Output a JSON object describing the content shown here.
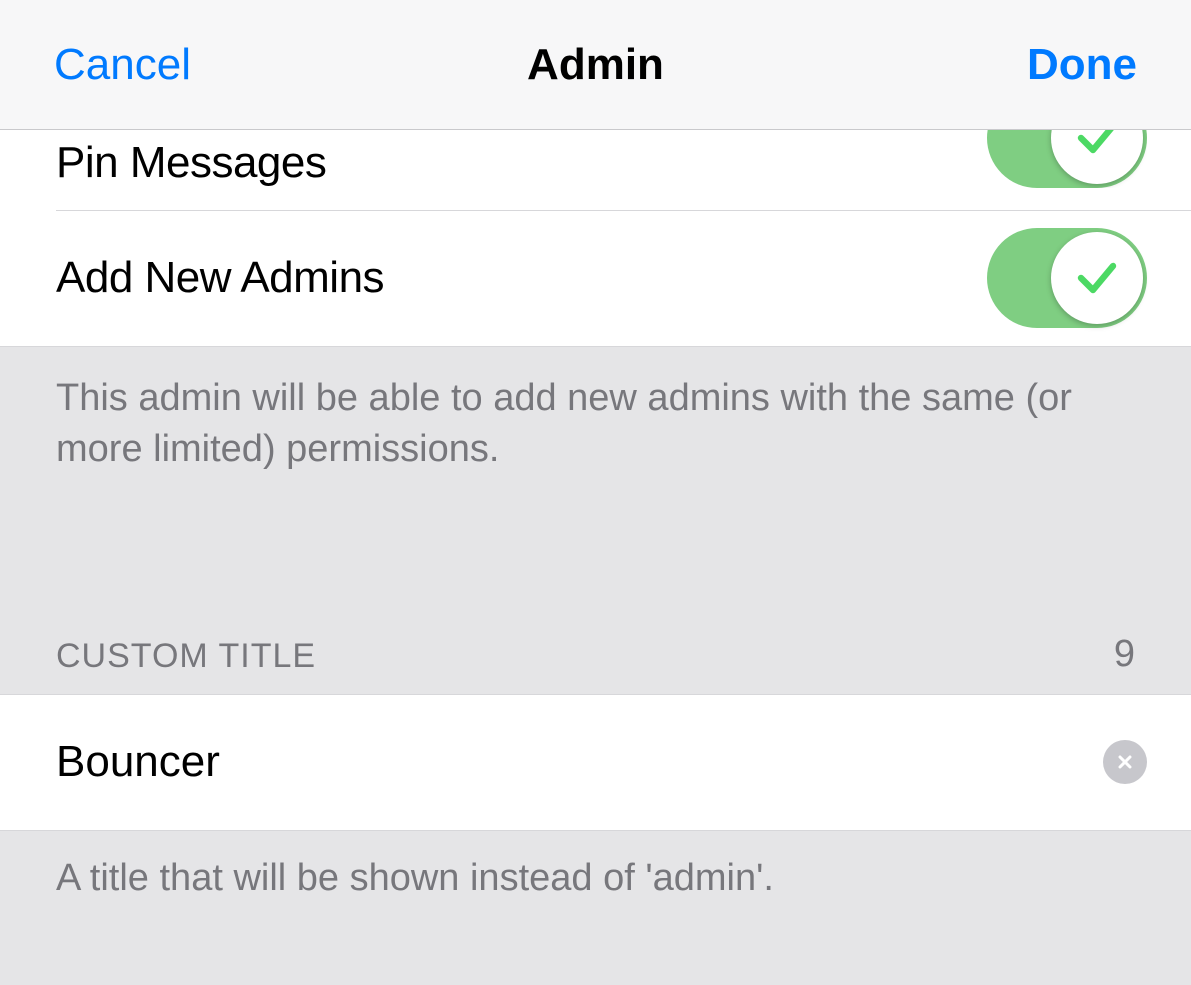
{
  "nav": {
    "cancel": "Cancel",
    "title": "Admin",
    "done": "Done"
  },
  "permissions": {
    "pin_messages": {
      "label": "Pin Messages",
      "enabled": true
    },
    "add_new_admins": {
      "label": "Add New Admins",
      "enabled": true
    },
    "footer": "This admin will be able to add new admins with the same (or more limited) permissions."
  },
  "custom_title": {
    "header": "CUSTOM TITLE",
    "remaining": "9",
    "value": "Bouncer",
    "footer": "A title that will be shown instead of 'admin'."
  }
}
